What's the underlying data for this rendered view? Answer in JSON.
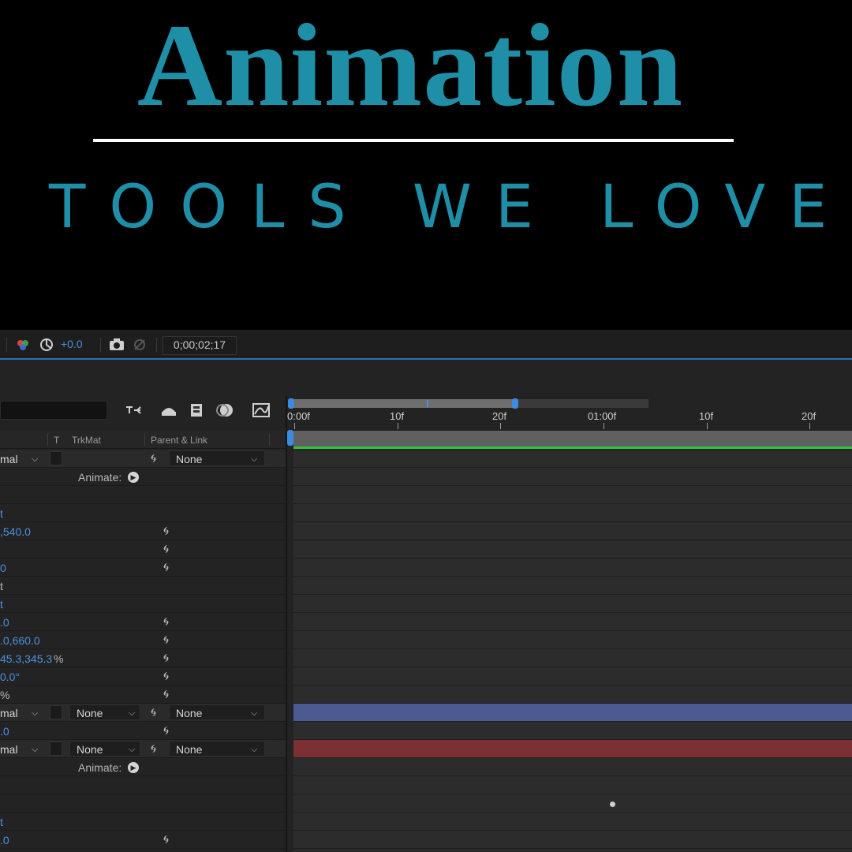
{
  "hero": {
    "title": "Animation",
    "subtitle": "TOOLS WE LOVE"
  },
  "toolbar": {
    "exposure_value": "+0.0",
    "timecode": "0;00;02;17"
  },
  "search": {
    "placeholder": ""
  },
  "ruler": {
    "labels": [
      "0:00f",
      "10f",
      "20f",
      "01:00f",
      "10f",
      "20f"
    ]
  },
  "columns": {
    "track_matte_t": "T",
    "track_matte": "TrkMat",
    "parent": "Parent & Link"
  },
  "rows": {
    "r0_mode": "mal",
    "r0_parent": "None",
    "r1_animate": "Animate:",
    "r3_value": "t",
    "r4_value": ",540.0",
    "r6_value": "0",
    "r7_value": "t",
    "r8_value": "t",
    "r9_value": ".0",
    "r10_value": ".0,660.0",
    "r11_value": "45.3,345.3",
    "r11_suffix": "%",
    "r12_value": "0.0°",
    "r13_suffix": "%",
    "r14_mode": "mal",
    "r14_matte": "None",
    "r14_parent": "None",
    "r15_value": ".0",
    "r16_mode": "mal",
    "r16_matte": "None",
    "r16_parent": "None",
    "r17_animate": "Animate:",
    "r20_value": "t",
    "r21_value": ".0"
  },
  "colors": {
    "accent": "#1f8fa8",
    "value_blue": "#4a90e2",
    "layer_blue": "#4c5a92",
    "layer_red": "#7c3034",
    "workarea_green": "#34c23b"
  }
}
